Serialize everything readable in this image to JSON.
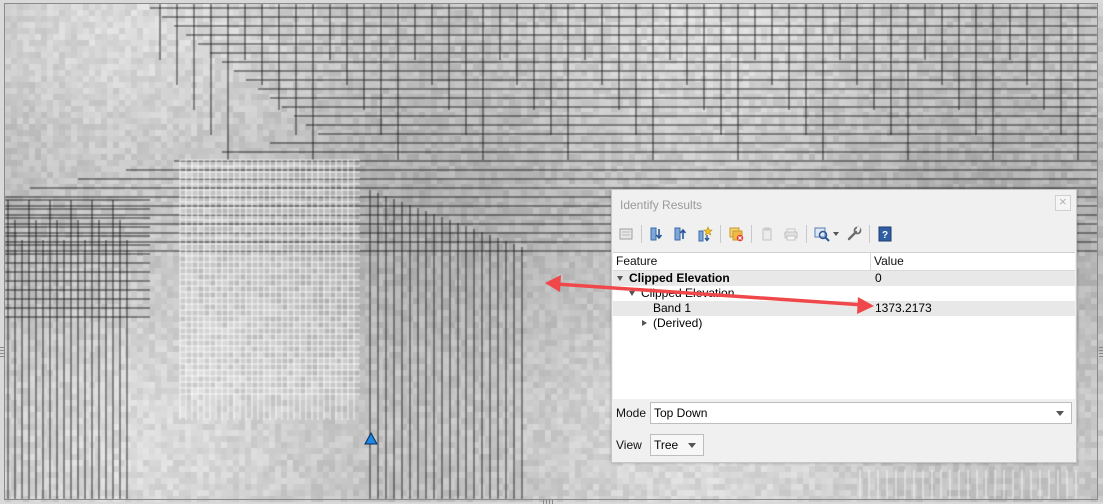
{
  "map": {
    "canvas_name": "map-canvas",
    "marker_color": "#1e88e5",
    "annotation_color": "#f0484a"
  },
  "identify": {
    "title": "Identify Results",
    "toolbar_icons": [
      "clear-results-icon",
      "expand-tree-icon",
      "collapse-tree-icon",
      "expand-new-results-icon",
      "clear-highlights-icon",
      "copy-feature-icon",
      "print-icon",
      "identify-selection-mode-icon",
      "settings-wrench-icon",
      "help-icon"
    ],
    "columns": {
      "feature": "Feature",
      "value": "Value"
    },
    "rows": [
      {
        "feature": "Clipped Elevation",
        "value": "0",
        "level": 0,
        "expanded": true,
        "bold": true
      },
      {
        "feature": "Clipped Elevation",
        "value": "",
        "level": 1,
        "expanded": true,
        "bold": false
      },
      {
        "feature": "Band 1",
        "value": "1373.2173",
        "level": 2,
        "expanded": null,
        "bold": false
      },
      {
        "feature": "(Derived)",
        "value": "",
        "level": 2,
        "expanded": false,
        "bold": false
      }
    ],
    "mode_label": "Mode",
    "mode_value": "Top Down",
    "view_label": "View",
    "view_value": "Tree"
  }
}
